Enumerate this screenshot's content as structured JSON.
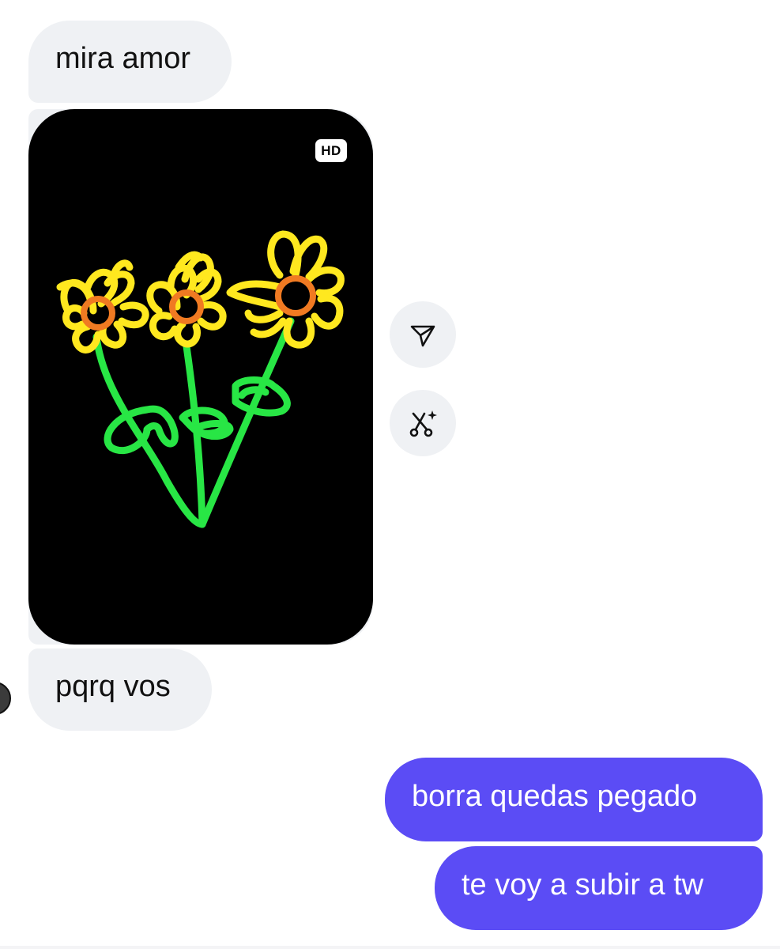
{
  "messages": [
    {
      "id": "msg-1",
      "direction": "incoming",
      "text": "mira amor"
    },
    {
      "id": "msg-2",
      "direction": "incoming",
      "text": "pqrq vos"
    },
    {
      "id": "msg-3",
      "direction": "outgoing",
      "text": "borra quedas pegado"
    },
    {
      "id": "msg-4",
      "direction": "outgoing",
      "text": "te voy a subir a tw"
    }
  ],
  "image_message": {
    "badge": "HD",
    "content": "drawing-of-three-sunflowers-icon"
  },
  "actions": {
    "share_icon": "send-icon",
    "cutout_icon": "scissors-sparkle-icon"
  },
  "colors": {
    "incoming_bubble": "#eff1f4",
    "outgoing_bubble": "#5b4cf5",
    "petal": "#ffe81f",
    "center": "#f07a22",
    "stem": "#28e645"
  }
}
